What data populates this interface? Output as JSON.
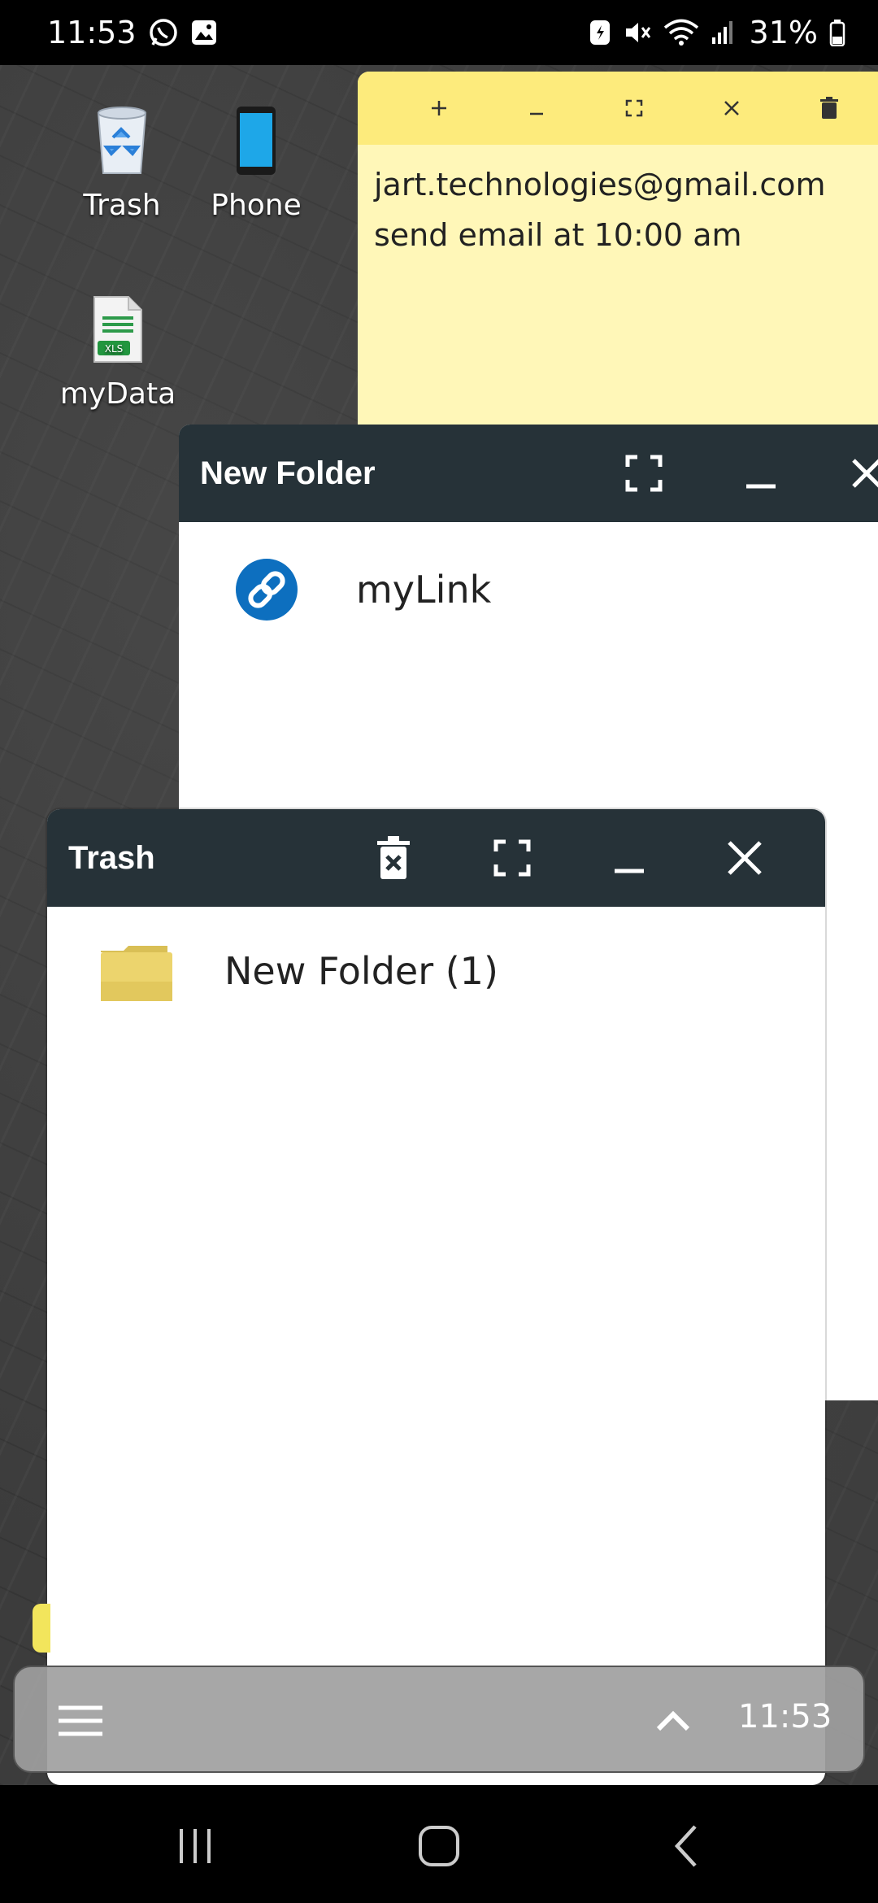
{
  "status_bar": {
    "time": "11:53",
    "battery": "31%",
    "icons": [
      "whatsapp-icon",
      "gallery-icon",
      "battery-saver-icon",
      "mute-icon",
      "wifi-icon",
      "signal-icon",
      "battery-icon"
    ]
  },
  "desktop": {
    "icons": [
      {
        "name": "trash",
        "label": "Trash",
        "icon": "recycle-bin-icon"
      },
      {
        "name": "phone",
        "label": "Phone",
        "icon": "phone-icon"
      },
      {
        "name": "mydata",
        "label": "myData",
        "icon": "xls-file-icon",
        "badge": "XLS"
      }
    ]
  },
  "sticky_note": {
    "lines": [
      "jart.technologies@gmail.com",
      "send email at 10:00 am"
    ],
    "toolbar": [
      "add-icon",
      "minimize-icon",
      "maximize-icon",
      "close-icon",
      "delete-icon"
    ]
  },
  "folder_window": {
    "title": "New Folder",
    "items": [
      {
        "label": "myLink",
        "icon": "link-icon"
      }
    ]
  },
  "trash_window": {
    "title": "Trash",
    "items": [
      {
        "label": "New Folder (1)",
        "icon": "folder-icon"
      }
    ]
  },
  "taskbar": {
    "clock": "11:53"
  },
  "colors": {
    "window_header": "#263238",
    "sticky_bg": "#fff7b8",
    "sticky_toolbar": "#fdeb7c",
    "link_blue": "#0d6fbf"
  }
}
